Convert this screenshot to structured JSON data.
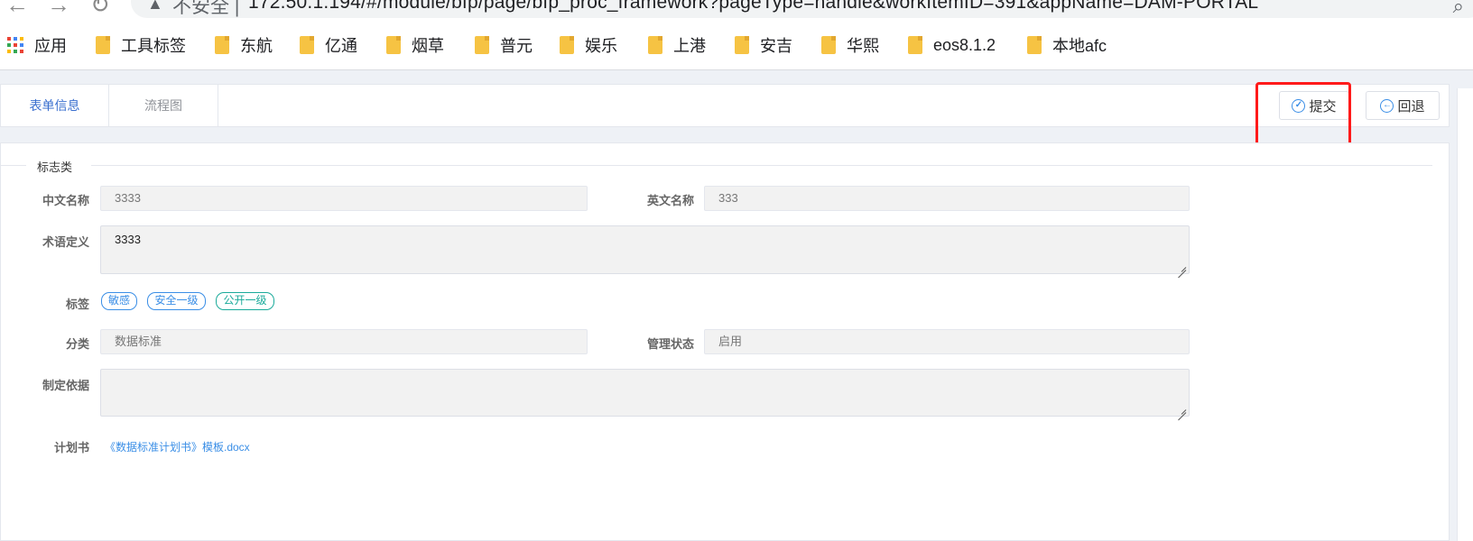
{
  "browser": {
    "insecure_label": "不安全 |",
    "url": "172.50.1.194/#/module/bfp/page/bfp_proc_framework?pageType=handle&workItemID=391&appName=DAM-PORTAL",
    "bookmarks": [
      {
        "label": "应用",
        "icon": "apps-grid-icon"
      },
      {
        "label": "工具标签",
        "icon": "folder-icon"
      },
      {
        "label": "东航",
        "icon": "folder-icon"
      },
      {
        "label": "亿通",
        "icon": "folder-icon"
      },
      {
        "label": "烟草",
        "icon": "folder-icon"
      },
      {
        "label": "普元",
        "icon": "folder-icon"
      },
      {
        "label": "娱乐",
        "icon": "folder-icon"
      },
      {
        "label": "上港",
        "icon": "folder-icon"
      },
      {
        "label": "安吉",
        "icon": "folder-icon"
      },
      {
        "label": "华熙",
        "icon": "folder-icon"
      },
      {
        "label": "eos8.1.2",
        "icon": "folder-icon"
      },
      {
        "label": "本地afc",
        "icon": "folder-icon"
      }
    ]
  },
  "tabs": [
    {
      "label": "表单信息",
      "active": true
    },
    {
      "label": "流程图",
      "active": false
    }
  ],
  "actions": {
    "submit_label": "提交",
    "back_label": "回退"
  },
  "section": {
    "title": "标志类"
  },
  "form": {
    "cn_name_label": "中文名称",
    "cn_name_value": "3333",
    "en_name_label": "英文名称",
    "en_name_value": "333",
    "definition_label": "术语定义",
    "definition_value": "3333",
    "tags_label": "标签",
    "tags": [
      {
        "label": "敏感",
        "color": "#3a8ee6"
      },
      {
        "label": "安全一级",
        "color": "#3a8ee6"
      },
      {
        "label": "公开一级",
        "color": "#1aaa9a"
      }
    ],
    "category_label": "分类",
    "category_value": "数据标准",
    "status_label": "管理状态",
    "status_value": "启用",
    "basis_label": "制定依据",
    "basis_value": "",
    "plan_label": "计划书",
    "plan_file": "《数据标准计划书》模板.docx"
  },
  "colors": {
    "accent": "#3a8ee6",
    "highlight": "#ff1a1a",
    "tag_green": "#1aaa9a"
  }
}
